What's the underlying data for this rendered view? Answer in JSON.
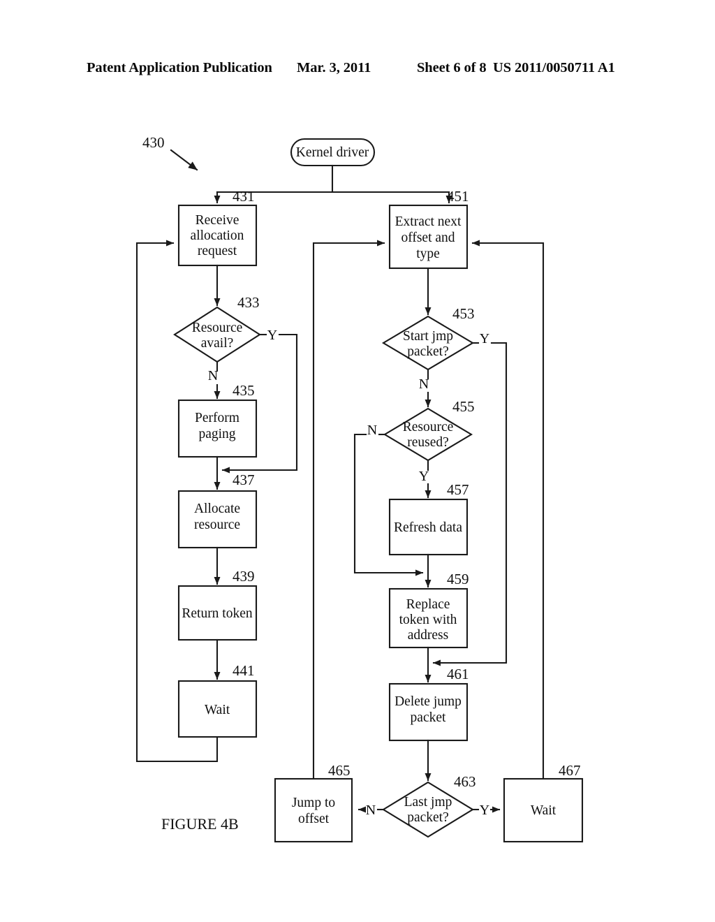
{
  "header": {
    "publication": "Patent Application Publication",
    "date": "Mar. 3, 2011",
    "sheet": "Sheet 6 of 8",
    "patent_number": "US 2011/0050711 A1"
  },
  "figure": {
    "caption": "FIGURE 4B",
    "diagram_ref": "430",
    "start_node": "Kernel driver"
  },
  "nodes": {
    "n431": {
      "ref": "431",
      "label_1": "Receive",
      "label_2": "allocation",
      "label_3": "request"
    },
    "n433": {
      "ref": "433",
      "label_1": "Resource",
      "label_2": "avail?"
    },
    "n435": {
      "ref": "435",
      "label_1": "Perform",
      "label_2": "paging"
    },
    "n437": {
      "ref": "437",
      "label_1": "Allocate",
      "label_2": "resource"
    },
    "n439": {
      "ref": "439",
      "label_1": "Return token"
    },
    "n441": {
      "ref": "441",
      "label_1": "Wait"
    },
    "n451": {
      "ref": "451",
      "label_1": "Extract next",
      "label_2": "offset and",
      "label_3": "type"
    },
    "n453": {
      "ref": "453",
      "label_1": "Start jmp",
      "label_2": "packet?"
    },
    "n455": {
      "ref": "455",
      "label_1": "Resource",
      "label_2": "reused?"
    },
    "n457": {
      "ref": "457",
      "label_1": "Refresh data"
    },
    "n459": {
      "ref": "459",
      "label_1": "Replace",
      "label_2": "token with",
      "label_3": "address"
    },
    "n461": {
      "ref": "461",
      "label_1": "Delete jump",
      "label_2": "packet"
    },
    "n463": {
      "ref": "463",
      "label_1": "Last jmp",
      "label_2": "packet?"
    },
    "n465": {
      "ref": "465",
      "label_1": "Jump to",
      "label_2": "offset"
    },
    "n467": {
      "ref": "467",
      "label_1": "Wait"
    }
  },
  "branches": {
    "b433_yes": "Y",
    "b433_no": "N",
    "b453_yes": "Y",
    "b453_no": "N",
    "b455_no": "N",
    "b455_yes": "Y",
    "b463_no": "N",
    "b463_yes": "Y"
  },
  "colors": {
    "ink": "#1a1a1a",
    "paper": "#ffffff"
  }
}
